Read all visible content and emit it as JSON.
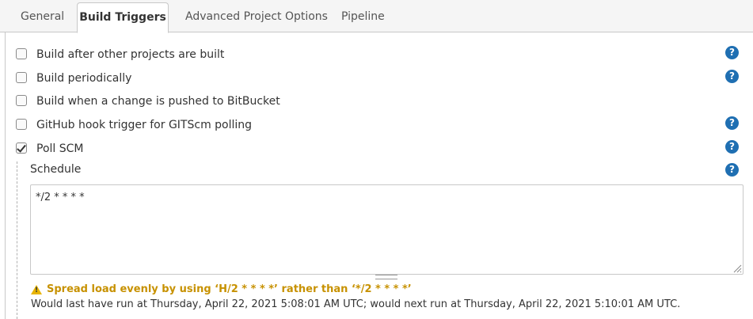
{
  "tabs": [
    {
      "label": "General"
    },
    {
      "label": "Build Triggers"
    },
    {
      "label": "Advanced Project Options"
    },
    {
      "label": "Pipeline"
    }
  ],
  "active_tab": "Build Triggers",
  "triggers": [
    {
      "label": "Build after other projects are built",
      "checked": false,
      "help": true
    },
    {
      "label": "Build periodically",
      "checked": false,
      "help": true
    },
    {
      "label": "Build when a change is pushed to BitBucket",
      "checked": false,
      "help": false
    },
    {
      "label": "GitHub hook trigger for GITScm polling",
      "checked": false,
      "help": true
    },
    {
      "label": "Poll SCM",
      "checked": true,
      "help": true
    }
  ],
  "schedule": {
    "label": "Schedule",
    "value": "*/2 * * * *",
    "warning": "Spread load evenly by using ‘H/2 * * * *’ rather than ‘*/2 * * * *’",
    "info": "Would last have run at Thursday, April 22, 2021 5:08:01 AM UTC; would next run at Thursday, April 22, 2021 5:10:01 AM UTC."
  },
  "help_glyph": "?",
  "warning_glyph": "!",
  "colors": {
    "help_icon": "#1f6fb2",
    "warning_text": "#c79100",
    "warning_icon": "#e8b400"
  }
}
